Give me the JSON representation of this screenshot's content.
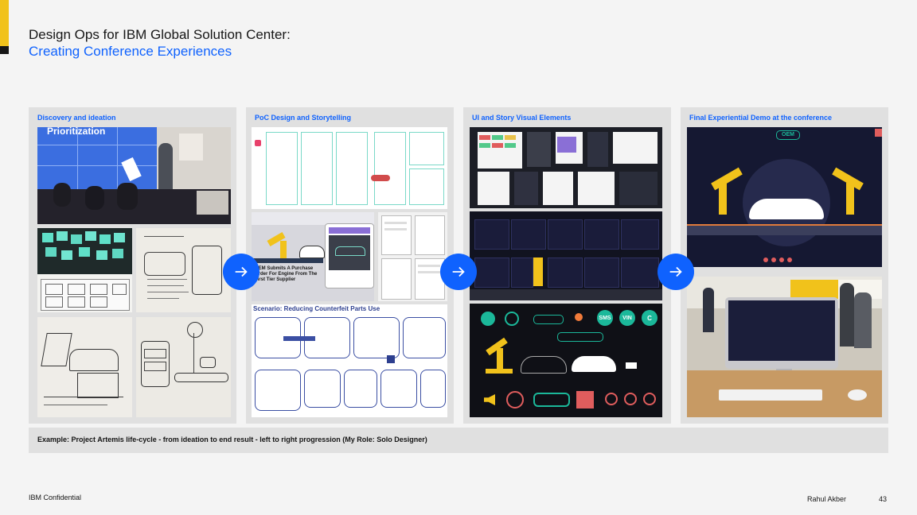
{
  "title": "Design Ops for IBM Global Solution Center:",
  "subtitle": "Creating Conference Experiences",
  "panels": [
    {
      "label": "Discovery and ideation",
      "photo_text": "Prioritization"
    },
    {
      "label": "PoC Design and Storytelling",
      "tablet_text": "OEM Submits A Purchase Order For Engine From The First Tier Supplier",
      "scenario_title": "Scenario: Reducing Counterfeit Parts Use"
    },
    {
      "label": "UI and Story Visual Elements",
      "icon_labels": [
        "SMS",
        "VIN",
        "C"
      ]
    },
    {
      "label": "Final Experiential Demo at the conference",
      "screen_sign": "OEM"
    }
  ],
  "caption": "Example: Project Artemis life-cycle - from ideation to end result - left to right progression (My Role: Solo Designer)",
  "footer": {
    "confidential": "IBM Confidential",
    "author": "Rahul Akber",
    "page": "43"
  },
  "colors": {
    "accent_yellow": "#f1c21b",
    "ibm_blue": "#0f62fe"
  }
}
